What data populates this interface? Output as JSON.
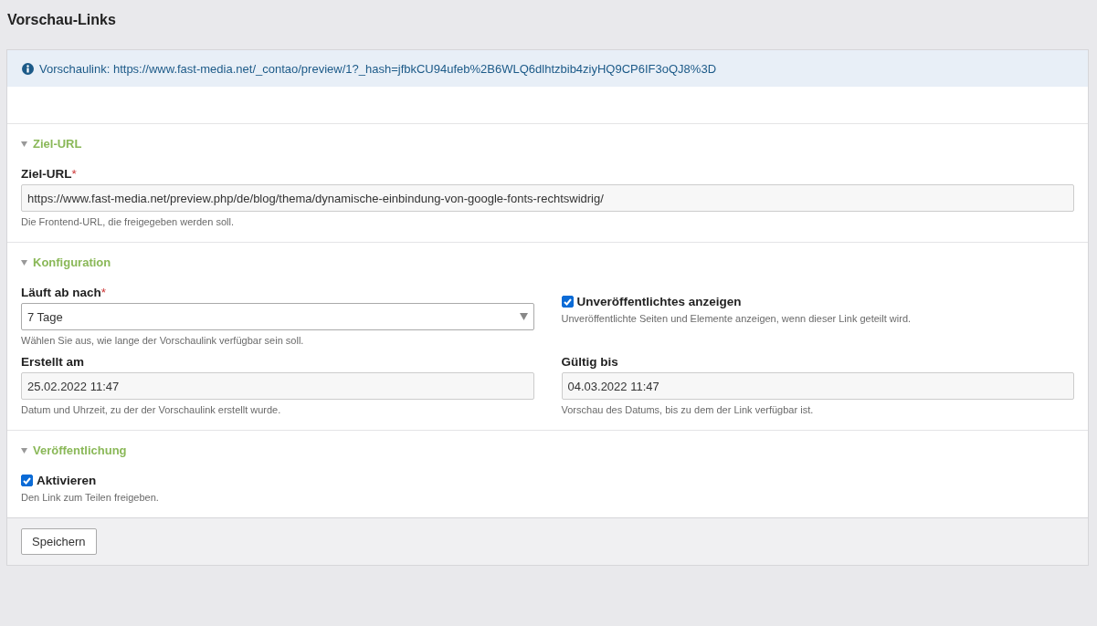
{
  "page_title": "Vorschau-Links",
  "info": {
    "text": "Vorschaulink: https://www.fast-media.net/_contao/preview/1?_hash=jfbkCU94ufeb%2B6WLQ6dlhtzbib4ziyHQ9CP6IF3oQJ8%3D"
  },
  "sections": [
    {
      "legend": "Ziel-URL",
      "expanded": true,
      "kind": "single",
      "fields": [
        {
          "kind": "text",
          "label": "Ziel-URL",
          "required_mark": "*",
          "value": "https://www.fast-media.net/preview.php/de/blog/thema/dynamische-einbindung-von-google-fonts-rechtswidrig/",
          "help": "Die Frontend-URL, die freigegeben werden soll."
        }
      ]
    },
    {
      "legend": "Konfiguration",
      "expanded": true,
      "kind": "grid",
      "fields": [
        {
          "kind": "select",
          "label": "Läuft ab nach",
          "required_mark": "*",
          "value": "7 Tage",
          "help": "Wählen Sie aus, wie lange der Vorschaulink verfügbar sein soll."
        },
        {
          "kind": "checkbox",
          "label": "Unveröffentlichtes anzeigen",
          "checked": true,
          "help": "Unveröffentlichte Seiten und Elemente anzeigen, wenn dieser Link geteilt wird."
        },
        {
          "kind": "text",
          "label": "Erstellt am",
          "value": "25.02.2022 11:47",
          "help": "Datum und Uhrzeit, zu der der Vorschaulink erstellt wurde."
        },
        {
          "kind": "text",
          "label": "Gültig bis",
          "value": "04.03.2022 11:47",
          "help": "Vorschau des Datums, bis zu dem der Link verfügbar ist."
        }
      ]
    },
    {
      "legend": "Veröffentlichung",
      "expanded": true,
      "kind": "grid",
      "fields": [
        {
          "kind": "checkbox",
          "label": "Aktivieren",
          "checked": true,
          "help": "Den Link zum Teilen freigeben."
        }
      ]
    }
  ],
  "buttons": [
    "Speichern"
  ]
}
